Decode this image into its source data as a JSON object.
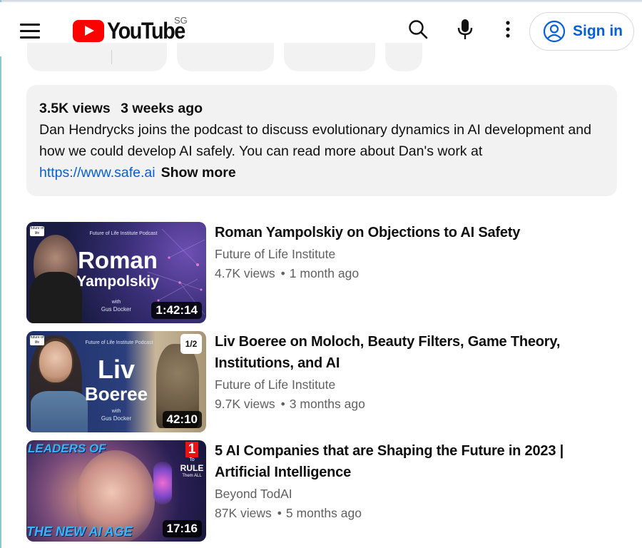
{
  "header": {
    "logo_text": "YouTube",
    "country_code": "SG",
    "sign_in_label": "Sign in",
    "icons": [
      "menu-icon",
      "search-icon",
      "mic-icon",
      "more-vert-icon",
      "account-icon"
    ]
  },
  "description": {
    "views": "3.5K views",
    "age": "3 weeks ago",
    "text": "Dan Hendrycks joins the podcast to discuss evolutionary dynamics in AI development and how we could develop AI safely.  You can read more about Dan's work at ",
    "link": "https://www.safe.ai",
    "show_more": "Show more"
  },
  "videos": [
    {
      "title": "Roman Yampolskiy on Objections to AI Safety",
      "channel": "Future of Life Institute",
      "views": "4.7K views",
      "age": "1 month ago",
      "duration": "1:42:14",
      "thumb": {
        "logo": "future of life",
        "podcast": "Future of Life Institute Podcast",
        "line1": "Roman",
        "line2": "Yampolskiy",
        "with": "with",
        "host": "Gus Docker"
      }
    },
    {
      "title": "Liv Boeree on Moloch, Beauty Filters, Game Theory, Institutions, and AI",
      "channel": "Future of Life Institute",
      "views": "9.7K views",
      "age": "3 months ago",
      "duration": "42:10",
      "thumb": {
        "logo": "future of life",
        "podcast": "Future of Life Institute Podcast",
        "line1": "Liv",
        "line2": "Boeree",
        "with": "with",
        "host": "Gus Docker",
        "part": "1/2"
      }
    },
    {
      "title": "5 AI Companies that are Shaping the Future in 2023 | Artificial Intelligence",
      "channel": "Beyond TodAI",
      "views": "87K views",
      "age": "5 months ago",
      "duration": "17:16",
      "thumb": {
        "top": "LEADERS OF",
        "bottom": "THE NEW AI AGE",
        "badge_num": "1",
        "badge_to": "To",
        "badge_rule": "RULE",
        "badge_all": "Them ALL"
      }
    }
  ],
  "colors": {
    "brand_red": "#ff0000",
    "link_blue": "#065fd4",
    "secondary_text": "#606060",
    "panel_bg": "#f2f2f2"
  }
}
